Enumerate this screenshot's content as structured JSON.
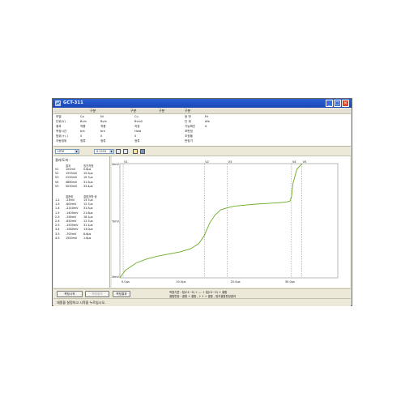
{
  "window": {
    "title": "GCT-311"
  },
  "info": {
    "header": [
      "구분",
      "구분",
      "구분",
      "구분"
    ],
    "rows": [
      [
        "모델",
        "Ca",
        "Ni",
        "Cu",
        "등 번",
        "Fe"
      ],
      [
        "단위(V)",
        "Bvin",
        "Bvin",
        "Bvin2",
        "단 위",
        "Afe"
      ],
      [
        "결과",
        "적용",
        "적용",
        "지정",
        "기능확인",
        "A"
      ],
      [
        "측정시간",
        "brk",
        "brk",
        "Hold",
        "포판정",
        ""
      ],
      [
        "범위(+/-)",
        "0",
        "0",
        "0",
        "조정율",
        ""
      ],
      [
        "자동범위",
        "정류",
        "정류",
        "정류",
        "판정기",
        ""
      ]
    ]
  },
  "toolbar": {
    "mode_select": "HTM",
    "value_select": "0.1151"
  },
  "left_panel": {
    "title": "결과/도피 :",
    "head1": [
      "결과",
      "정전저항"
    ],
    "rows1": [
      [
        "V1",
        "100mV",
        "0.6μs"
      ],
      [
        "V2",
        "1553mV",
        "15.5μs"
      ],
      [
        "V3",
        "2250mV",
        "19.7μs"
      ],
      [
        "V4",
        "4680mV",
        "31.5μs"
      ],
      [
        "V5",
        "5030mV",
        "33.4μs"
      ]
    ],
    "head2": [
      "결합량",
      "결합저항 량"
    ],
    "rows2": [
      [
        "1-2",
        "-23mV",
        "13.7μs"
      ],
      [
        "1-3",
        "-600mV",
        "12.7μs"
      ],
      [
        "1-4",
        "-2140mV",
        "31.5μs"
      ],
      [
        "1-5",
        "-1400mV",
        "21.6μs"
      ],
      [
        "2-3",
        "-258mV",
        "18.1μs"
      ],
      [
        "2-4",
        "-830mV",
        "12.7μs"
      ],
      [
        "2-5",
        "-1500mV",
        "31.1μs"
      ],
      [
        "3-4",
        "-1580mV",
        "13.0μs"
      ],
      [
        "3-5",
        "-700mV",
        "8.6μs"
      ],
      [
        "4-5",
        "1500mV",
        "1.6μs"
      ]
    ]
  },
  "chart_data": {
    "type": "line",
    "y_ticks": [
      "5040mV",
      "1170mV",
      "50mV"
    ],
    "x_ticks": [
      "0.0μs",
      "10.0μs",
      "20.0μs",
      "30.0μs"
    ],
    "xlim": [
      0,
      40
    ],
    "ylim": [
      50,
      5040
    ],
    "markers": [
      {
        "label": "V1",
        "x": 0.6
      },
      {
        "label": "V2",
        "x": 15.5
      },
      {
        "label": "V3",
        "x": 19.7
      },
      {
        "label": "V4",
        "x": 31.5
      },
      {
        "label": "V5",
        "x": 33.4
      }
    ],
    "series": [
      {
        "color": "#6bab24",
        "x": [
          0,
          1,
          3,
          5,
          7,
          9,
          11,
          13,
          14.5,
          15.5,
          16.5,
          17.5,
          18.5,
          19.7,
          21,
          23,
          25,
          27,
          29,
          30.5,
          31.2,
          31.5,
          31.8,
          32.5,
          33.4
        ],
        "y": [
          50,
          380,
          700,
          880,
          1000,
          1090,
          1180,
          1320,
          1550,
          1900,
          2450,
          2800,
          3020,
          3110,
          3180,
          3230,
          3270,
          3300,
          3330,
          3360,
          3400,
          3600,
          4200,
          4800,
          5030
        ]
      }
    ]
  },
  "bottom": {
    "btn_measure": "측정시작",
    "btn_stop": "측정중지",
    "btn_result": "측정결과",
    "legend1": "적정기준 : 정(C1~5) + --- + 정(C1~5) + 결합",
    "legend2": "결합판정 : 결합 + 결합 ,  + 1 + 결합 , 정지결합판정결과"
  },
  "statusbar": {
    "text": "대종을 설정하고 시작을 누르십시오."
  }
}
